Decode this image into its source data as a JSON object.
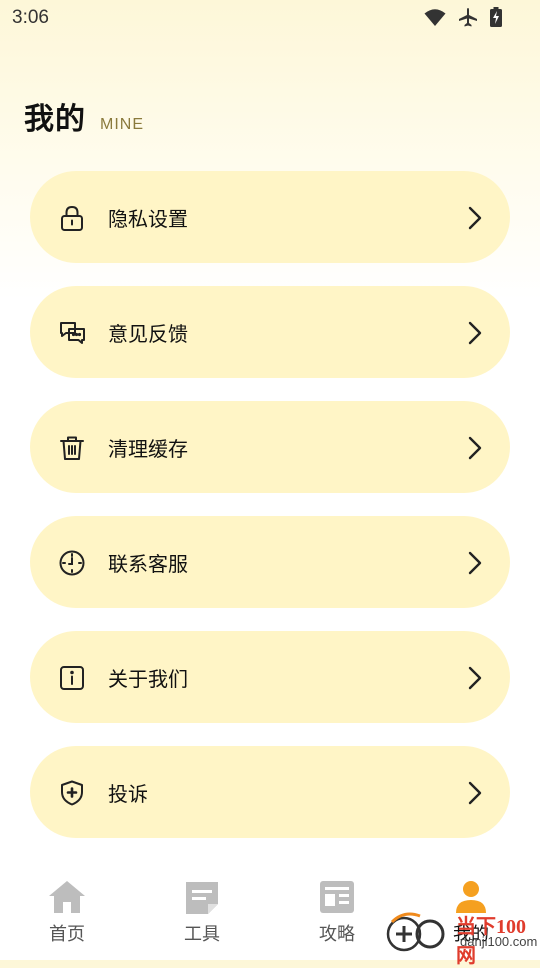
{
  "status_bar": {
    "time": "3:06",
    "icons": [
      "wifi-icon",
      "airplane-icon",
      "battery-charging-icon"
    ]
  },
  "header": {
    "title": "我的",
    "subtitle": "MINE"
  },
  "menu": {
    "items": [
      {
        "label": "隐私设置",
        "icon": "lock-icon"
      },
      {
        "label": "意见反馈",
        "icon": "chat-bubbles-icon"
      },
      {
        "label": "清理缓存",
        "icon": "trash-icon"
      },
      {
        "label": "联系客服",
        "icon": "clock-icon"
      },
      {
        "label": "关于我们",
        "icon": "info-icon"
      },
      {
        "label": "投诉",
        "icon": "shield-plus-icon"
      }
    ]
  },
  "bottom_nav": {
    "items": [
      {
        "label": "首页",
        "icon": "home-icon"
      },
      {
        "label": "工具",
        "icon": "document-icon"
      },
      {
        "label": "攻略",
        "icon": "news-icon"
      },
      {
        "label": "我的",
        "icon": "person-icon",
        "active": true
      }
    ]
  },
  "watermark": {
    "brand": "当下100网",
    "domain": "danji100.com"
  },
  "colors": {
    "card_bg": "#fff5c6",
    "active_nav": "#f5a020",
    "inactive_nav_icon": "#bdbdbd",
    "subtitle": "#8a7a3c"
  }
}
